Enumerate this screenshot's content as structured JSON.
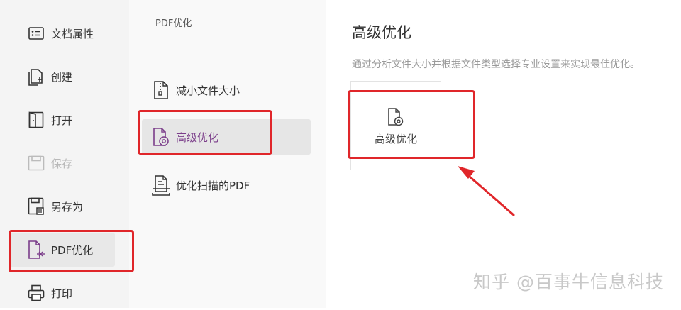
{
  "sidebar": {
    "items": [
      {
        "label": "文档属性",
        "icon": "document-properties-icon",
        "state": "normal"
      },
      {
        "label": "创建",
        "icon": "create-document-icon",
        "state": "normal"
      },
      {
        "label": "打开",
        "icon": "open-book-icon",
        "state": "normal"
      },
      {
        "label": "保存",
        "icon": "save-icon",
        "state": "disabled"
      },
      {
        "label": "另存为",
        "icon": "save-as-icon",
        "state": "normal"
      },
      {
        "label": "PDF优化",
        "icon": "pdf-optimize-icon",
        "state": "active"
      },
      {
        "label": "打印",
        "icon": "printer-icon",
        "state": "normal"
      }
    ]
  },
  "submenu": {
    "title": "PDF优化",
    "items": [
      {
        "label": "减小文件大小",
        "icon": "zip-file-icon",
        "state": "normal"
      },
      {
        "label": "高级优化",
        "icon": "advanced-optimize-icon",
        "state": "active"
      },
      {
        "label": "优化扫描的PDF",
        "icon": "scan-pdf-icon",
        "state": "normal"
      }
    ]
  },
  "content": {
    "title": "高级优化",
    "description": "通过分析文件大小并根据文件类型选择专业设置来实现最佳优化。",
    "card": {
      "label": "高级优化",
      "icon": "advanced-optimize-icon"
    }
  },
  "watermark": "知乎 @百事牛信息科技",
  "colors": {
    "accent_purple": "#7b3d8a",
    "highlight_red": "#e0262a"
  }
}
